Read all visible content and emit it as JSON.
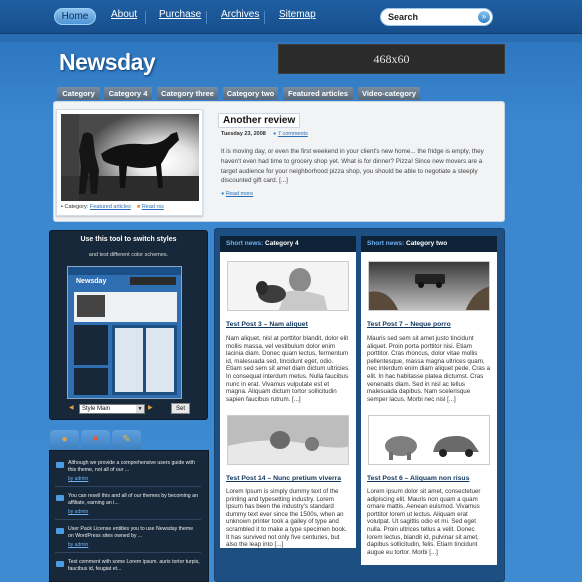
{
  "nav": {
    "items": [
      "Home",
      "About",
      "Purchase",
      "Archives",
      "Sitemap"
    ],
    "search_label": "Search",
    "search_button": "»"
  },
  "header": {
    "logo": "Newsday",
    "ad_text": "468x60"
  },
  "categories": [
    "Category",
    "Category 4",
    "Category three",
    "Category two",
    "Featured articles",
    "Video-category"
  ],
  "featured": {
    "title": "Another review",
    "date": "Tuesday 23, 2008",
    "comments": "7 comments",
    "text": "It is moving day, or even the first weekend in your client's new home... the fridge is empty, they haven't even had time to grocery shop yet. What is for dinner? Pizza! Since new movers are a target audience for your neighborhood pizza shop, you should be able to negotiate a steeply discounted gift card. [...]",
    "read_more": "Read more",
    "category_label": "Category:",
    "category_link": "Featured articles",
    "rss_link": "Read rss"
  },
  "switcher": {
    "title": "Use this tool to switch styles",
    "subtitle": "and test different color schemes.",
    "select_value": "Style Main",
    "set_button": "Set",
    "preview_logo": "Newsday"
  },
  "widget": {
    "tab_icons": [
      "comments-icon",
      "heart-icon",
      "pencil-icon"
    ],
    "items": [
      {
        "text": "Although we provide a comprehensive users guide with this theme, not all of our ...",
        "by": "by admin"
      },
      {
        "text": "You can resell this and all of our themes by becoming an affiliate, earning an i...",
        "by": "by admin"
      },
      {
        "text": "User Pack License entitles you to use Newsday theme on WordPress sites owned by ...",
        "by": "by admin"
      },
      {
        "text": "Test comment with some Lorem ipsum. auris tortor turpis, faucibus id, feugiat et...",
        "by": "by admin"
      }
    ]
  },
  "columns": [
    {
      "label": "Short news:",
      "category": "Category 4",
      "posts": [
        {
          "title": "Test Post 3 – Nam aliquet",
          "text": "Nam aliquet, nisl at porttitor blandit, dolor elit mollis massa, vel vestibulum dolor enim lacinia diam. Donec quam lectus, fermentum id, malesuada sed, tincidunt eget, odio. Etiam sed sem sit amet diam dictum ultricies. In consequat interdum metus. Nulla faucibus nunc in erat. Vivamus vulputate est et magna. Aliquam dictum tortor sollicitudin sapien faucibus rutrum. [...]"
        },
        {
          "title": "Test Post 14 – Nunc pretium viverra",
          "text": "Lorem Ipsum is simply dummy text of the printing and typesetting industry. Lorem Ipsum has been the industry's standard dummy text ever since the 1500s, when an unknown printer took a galley of type and scrambled it to make a type specimen book. It has survived not only five centuries, but also the leap into [...]"
        }
      ]
    },
    {
      "label": "Short news:",
      "category": "Category two",
      "posts": [
        {
          "title": "Test Post 7 – Neque porro",
          "text": "Mauris sed sem sit amet justo tincidunt aliquet. Proin porta porttitor nisi. Etiam porttitor. Cras rhoncus, dolor vitae mollis pellentesque, massa magna ultrices quam, nec interdum enim diam aliquet pede. Cras a elit. In hac habitasse platea dictumst. Cras venenatis diam. Sed in nisl ac tellus malesuada dapibus. Nam scelerisque semper lacus. Morbi nec nisl [...]"
        },
        {
          "title": "Test Post 6 – Aliquam non risus",
          "text": "Lorem ipsum dolor sit amet, consectetuer adipiscing elit. Mauris non quam a quam ornare mattis. Aenean euismod. Vivamus porttitor lorem ut lectus. Aliquam erat volutpat. Ut sagittis odio et mi. Sed eget nulla. Proin ultrices tellus a velit. Donec lorem lectus, blandit id, pulvinar sit amet, dapibus sollicitudin, felis. Etiam tincidunt augue eu tortor. Morbi [...]"
        }
      ]
    }
  ]
}
